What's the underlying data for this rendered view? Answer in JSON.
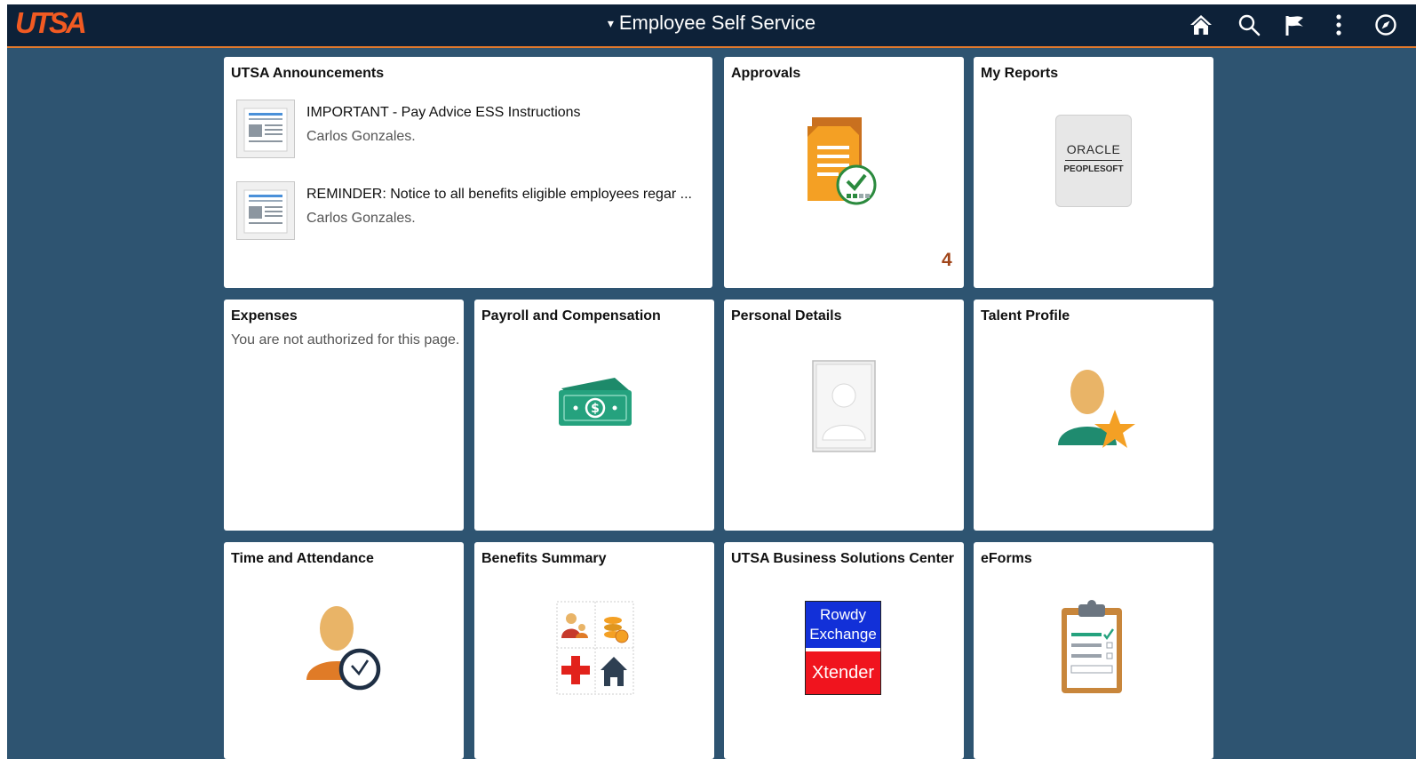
{
  "header": {
    "logo": "UTSA",
    "title": "Employee Self Service",
    "title_arrow": "▾",
    "icons": [
      "home-icon",
      "search-icon",
      "flag-icon",
      "more-vertical-icon",
      "compass-icon"
    ]
  },
  "tiles": {
    "announcements": {
      "title": "UTSA Announcements",
      "items": [
        {
          "title": "IMPORTANT - Pay Advice ESS Instructions",
          "author": "Carlos Gonzales."
        },
        {
          "title": "REMINDER: Notice to all benefits eligible employees regar ...",
          "author": "Carlos Gonzales."
        }
      ]
    },
    "approvals": {
      "title": "Approvals",
      "badge": "4"
    },
    "my_reports": {
      "title": "My Reports",
      "logo_line1": "ORACLE",
      "logo_line2": "PEOPLESOFT"
    },
    "expenses": {
      "title": "Expenses",
      "message": "You are not authorized for this page."
    },
    "payroll": {
      "title": "Payroll and Compensation"
    },
    "personal_details": {
      "title": "Personal Details"
    },
    "talent_profile": {
      "title": "Talent Profile"
    },
    "time_attendance": {
      "title": "Time and Attendance"
    },
    "benefits_summary": {
      "title": "Benefits Summary"
    },
    "business_center": {
      "title": "UTSA Business Solutions Center",
      "logo_top_line1": "Rowdy",
      "logo_top_line2": "Exchange",
      "logo_bottom": "Xtender"
    },
    "eforms": {
      "title": "eForms"
    }
  },
  "colors": {
    "background": "#2e5471",
    "header": "#0d2138",
    "accent": "#f15a22",
    "badge": "#a0451a"
  }
}
